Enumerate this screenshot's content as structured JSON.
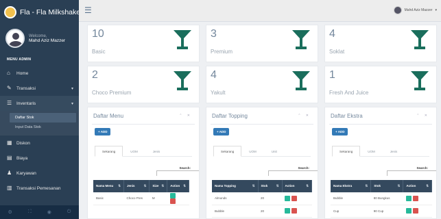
{
  "app": {
    "title": "Fla - Fla Milkshake"
  },
  "colors": {
    "sidebar": "#2a3f54",
    "accent": "#1a6e5c",
    "primary": "#337ab7",
    "success": "#26b99a",
    "danger": "#d9534f"
  },
  "profile": {
    "welcome": "Welcome,",
    "name": "Mahd Aziz Mazzer"
  },
  "nav": {
    "section": "MENU ADMIN",
    "home": "Home",
    "transaksi": "Transaksi",
    "inventaris": "Inventaris",
    "sub_daftar": "Daftar Stok",
    "sub_input": "Input Data Stok",
    "diskon": "Diskon",
    "biaya": "Biaya",
    "karyawan": "Karyawan",
    "transaksi_pemesanan": "Transaksi Pemesanan"
  },
  "topbar": {
    "user": "Mahd Aziz Mazzer"
  },
  "tiles": [
    {
      "count": "10",
      "label": "Basic"
    },
    {
      "count": "3",
      "label": "Premium"
    },
    {
      "count": "4",
      "label": "Soklat"
    },
    {
      "count": "2",
      "label": "Choco Premium"
    },
    {
      "count": "4",
      "label": "Yakult"
    },
    {
      "count": "1",
      "label": "Fresh And Juice"
    }
  ],
  "panels": {
    "menu": {
      "title": "Daftar Menu",
      "add": "ADD",
      "tabs": [
        "Sekarang",
        "UOM",
        "Jenis"
      ],
      "search": "Search:",
      "headers": [
        "Nama Menu",
        "Jenis",
        "Size",
        "Action"
      ],
      "row": {
        "name": "Basic",
        "jenis": "Choco Pres",
        "size": "M"
      }
    },
    "topping": {
      "title": "Daftar Topping",
      "add": "ADD",
      "tabs": [
        "Sekarang",
        "UOM",
        "Unit"
      ],
      "search": "Search:",
      "headers": [
        "Nama Topping",
        "Stok",
        "Action"
      ],
      "rows": [
        {
          "name": "Almonds",
          "stok": "20"
        },
        {
          "name": "Bubble",
          "stok": "20"
        }
      ]
    },
    "ekstra": {
      "title": "Daftar Ekstra",
      "add": "ADD",
      "tabs": [
        "Sekarang",
        "UOM",
        "Jenis"
      ],
      "search": "Search:",
      "headers": [
        "Nama Ekstra",
        "Stok",
        "Action"
      ],
      "rows": [
        {
          "name": "Bubble",
          "stok": "80 Bungkus"
        },
        {
          "name": "Cup",
          "stok": "90 Cup"
        }
      ]
    }
  }
}
